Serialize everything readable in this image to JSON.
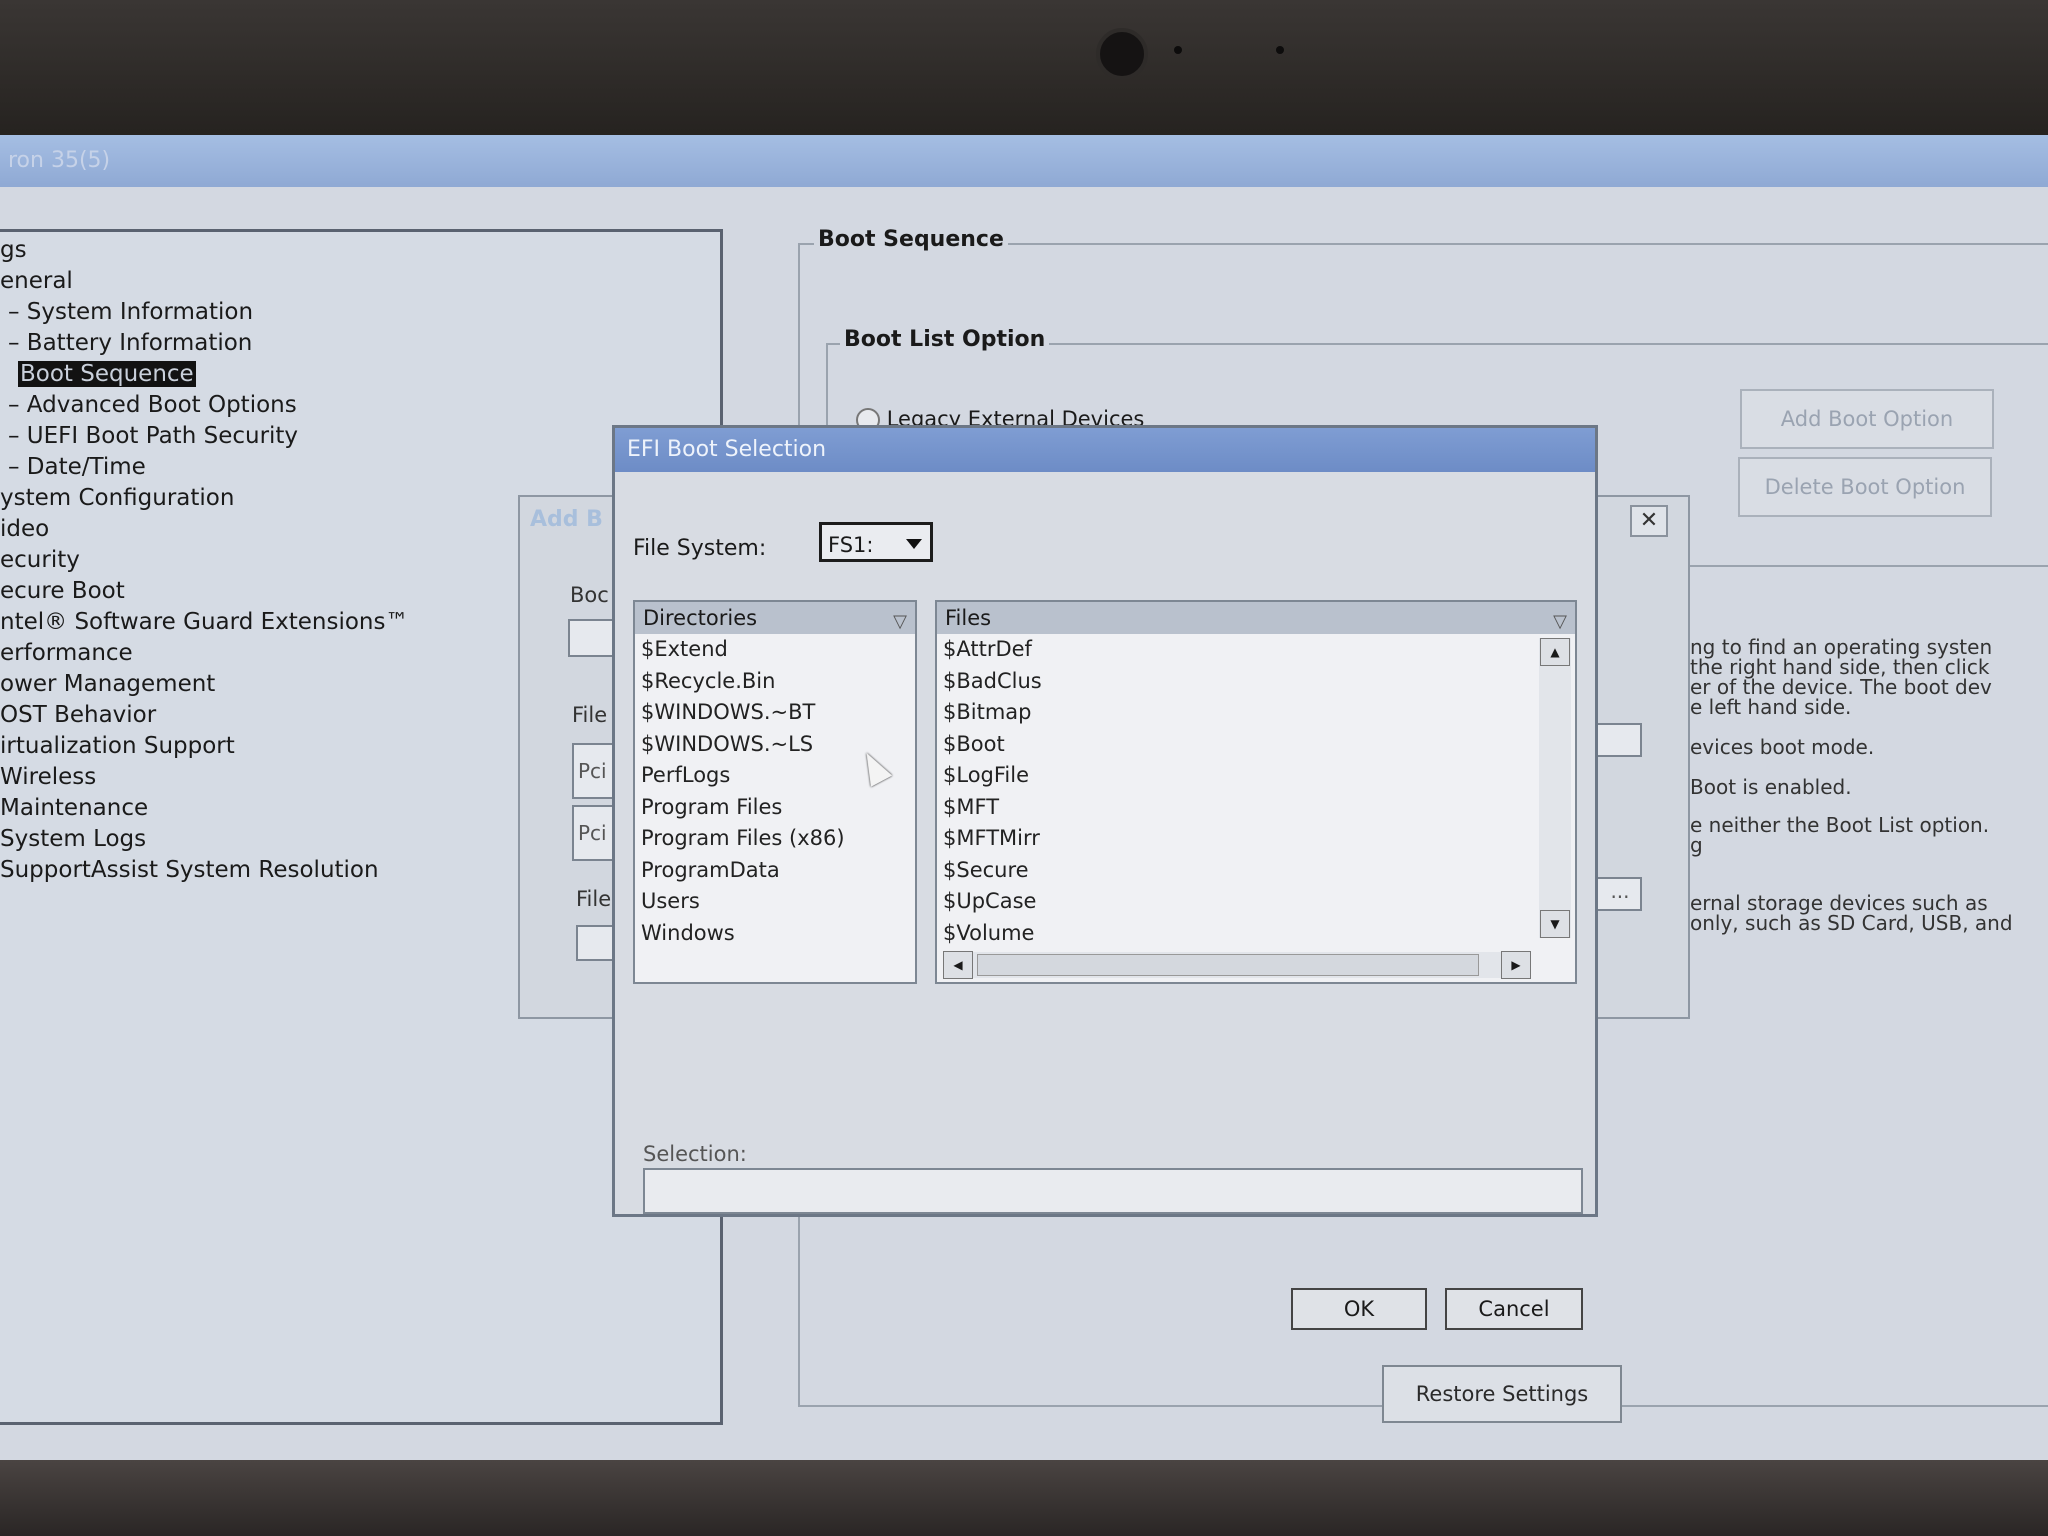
{
  "window": {
    "title": "ron 35(5)"
  },
  "tree": [
    {
      "label": "gs",
      "child": false
    },
    {
      "label": "eneral",
      "child": false
    },
    {
      "label": "– System Information",
      "child": true
    },
    {
      "label": "– Battery Information",
      "child": true
    },
    {
      "label": "Boot Sequence",
      "child": true,
      "selected": true
    },
    {
      "label": "– Advanced Boot Options",
      "child": true
    },
    {
      "label": "– UEFI Boot Path Security",
      "child": true
    },
    {
      "label": "– Date/Time",
      "child": true
    },
    {
      "label": "ystem Configuration",
      "child": false
    },
    {
      "label": "ideo",
      "child": false
    },
    {
      "label": "ecurity",
      "child": false
    },
    {
      "label": "ecure Boot",
      "child": false
    },
    {
      "label": "ntel® Software Guard Extensions™",
      "child": false
    },
    {
      "label": "erformance",
      "child": false
    },
    {
      "label": "ower Management",
      "child": false
    },
    {
      "label": "OST Behavior",
      "child": false
    },
    {
      "label": "irtualization Support",
      "child": false
    },
    {
      "label": "Wireless",
      "child": false
    },
    {
      "label": "Maintenance",
      "child": false
    },
    {
      "label": "System Logs",
      "child": false
    },
    {
      "label": "SupportAssist System Resolution",
      "child": false
    }
  ],
  "main": {
    "boot_sequence_legend": "Boot Sequence",
    "boot_list_legend": "Boot List Option",
    "legacy_radio_label": "Legacy External Devices",
    "add_boot_option": "Add Boot Option",
    "delete_boot_option": "Delete Boot Option",
    "help_lines": [
      "ng to find an operating systen",
      "the right hand side, then click",
      "er of the device. The boot dev",
      "e left hand side.",
      "evices boot mode.",
      "Boot is enabled.",
      "e neither the Boot List option.",
      "g",
      "ernal storage devices such as",
      "only, such as SD Card, USB, and"
    ],
    "restore_settings": "Restore Settings"
  },
  "add_dialog": {
    "title": "Add B",
    "close": "✕",
    "boot_label": "Boc",
    "file_label_1": "File",
    "pci_1": "Pci",
    "pci_2": "Pci",
    "file_label_2": "File",
    "browse": "..."
  },
  "efi_dialog": {
    "title": "EFI Boot Selection",
    "file_system_label": "File System:",
    "file_system_value": "FS1:",
    "directories_header": "Directories",
    "files_header": "Files",
    "directories": [
      "$Extend",
      "$Recycle.Bin",
      "$WINDOWS.~BT",
      "$WINDOWS.~LS",
      "PerfLogs",
      "Program Files",
      "Program Files (x86)",
      "ProgramData",
      "Users",
      "Windows"
    ],
    "files": [
      "$AttrDef",
      "$BadClus",
      "$Bitmap",
      "$Boot",
      "$LogFile",
      "$MFT",
      "$MFTMirr",
      "$Secure",
      "$UpCase",
      "$Volume"
    ],
    "selection_label": "Selection:",
    "selection_value": "",
    "ok": "OK",
    "cancel": "Cancel"
  },
  "icons": {
    "filter": "funnel-icon",
    "scroll_up": "arrow-up-icon",
    "scroll_down": "arrow-down-icon",
    "scroll_left": "arrow-left-icon",
    "scroll_right": "arrow-right-icon",
    "dropdown": "chevron-down-icon",
    "cursor": "mouse-pointer-icon"
  }
}
